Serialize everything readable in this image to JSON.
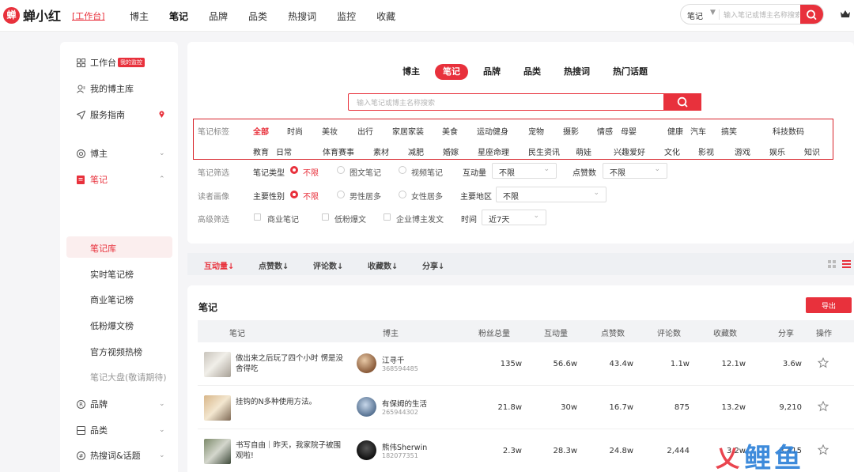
{
  "brand": {
    "logo_mark": "蝉",
    "name": "蝉小红",
    "workbench_link": "[工作台]"
  },
  "top_nav": [
    {
      "label": "博主",
      "active": false
    },
    {
      "label": "笔记",
      "active": true
    },
    {
      "label": "品牌",
      "active": false
    },
    {
      "label": "品类",
      "active": false
    },
    {
      "label": "热搜词",
      "active": false
    },
    {
      "label": "监控",
      "active": false
    },
    {
      "label": "收藏",
      "active": false
    }
  ],
  "top_search": {
    "scope": "笔记",
    "placeholder": "输入笔记或博主名称搜索"
  },
  "sidebar": {
    "workbench": {
      "label": "工作台",
      "badge": "我的监控"
    },
    "blogger_lib": {
      "label": "我的博主库"
    },
    "guide": {
      "label": "服务指南"
    },
    "blogger": {
      "label": "博主"
    },
    "notes": {
      "label": "笔记"
    },
    "notes_sub": [
      "笔记库",
      "实时笔记榜",
      "商业笔记榜",
      "低粉爆文榜",
      "官方视频热榜",
      "笔记大盘(敬请期待)"
    ],
    "brand": {
      "label": "品牌"
    },
    "category": {
      "label": "品类"
    },
    "hot": {
      "label": "热搜词&话题"
    }
  },
  "filter": {
    "tabs": [
      "博主",
      "笔记",
      "品牌",
      "品类",
      "热搜词",
      "热门话题"
    ],
    "active_tab": "笔记",
    "search_placeholder": "输入笔记或博主名称搜索",
    "tag_label": "笔记标签",
    "tags_row1": [
      "全部",
      "时尚",
      "美妆",
      "出行",
      "家居家装",
      "美食",
      "运动健身",
      "宠物",
      "摄影",
      "情感",
      "母婴",
      "健康",
      "汽车",
      "搞笑",
      "科技数码"
    ],
    "tags_row2": [
      "教育",
      "日常",
      "体育赛事",
      "素材",
      "减肥",
      "婚嫁",
      "星座命理",
      "民生资讯",
      "萌娃",
      "兴趣爱好",
      "文化",
      "影视",
      "游戏",
      "娱乐",
      "知识"
    ],
    "note_filter": {
      "label": "笔记筛选",
      "type_label": "笔记类型",
      "types": [
        "不限",
        "图文笔记",
        "视频笔记"
      ],
      "interact_label": "互动量",
      "interact_value": "不限",
      "likes_label": "点赞数",
      "likes_value": "不限"
    },
    "reader": {
      "label": "读者画像",
      "gender_label": "主要性别",
      "genders": [
        "不限",
        "男性居多",
        "女性居多"
      ],
      "region_label": "主要地区",
      "region_value": "不限"
    },
    "advanced": {
      "label": "高级筛选",
      "checks": [
        "商业笔记",
        "低粉爆文",
        "企业博主发文"
      ],
      "time_label": "时间",
      "time_value": "近7天"
    }
  },
  "sort_bar": [
    "互动量",
    "点赞数",
    "评论数",
    "收藏数",
    "分享"
  ],
  "table": {
    "title": "笔记",
    "export_label": "导出",
    "headers": [
      "笔记",
      "博主",
      "粉丝总量",
      "互动量",
      "点赞数",
      "评论数",
      "收藏数",
      "分享",
      "操作"
    ],
    "rows": [
      {
        "title": "做出来之后玩了四个小时 愣是没舍得吃",
        "blogger": "江寻千",
        "blogger_id": "368594485",
        "fans": "135w",
        "interact": "56.6w",
        "likes": "43.4w",
        "comments": "1.1w",
        "favorites": "12.1w",
        "shares": "3.6w"
      },
      {
        "title": "挂钩的N多种使用方法。",
        "blogger": "有保姆的生活",
        "blogger_id": "265944302",
        "fans": "21.8w",
        "interact": "30w",
        "likes": "16.7w",
        "comments": "875",
        "favorites": "13.2w",
        "shares": "9,210"
      },
      {
        "title": "书写自由｜昨天，我家院子被围观啦!",
        "blogger": "熊伟Sherwin",
        "blogger_id": "182077351",
        "fans": "2.3w",
        "interact": "28.3w",
        "likes": "24.8w",
        "comments": "2,444",
        "favorites": "3.2w",
        "shares": "3,415"
      }
    ]
  },
  "watermark": {
    "mark": "乂",
    "text": "鲤鱼"
  },
  "colors": {
    "accent": "#e8313c",
    "tag_box_border": "#d8232a",
    "page_bg": "#f5f5f7"
  },
  "icons": [
    "logo-mark-icon",
    "search-icon",
    "crown-icon",
    "grid-icon",
    "user-icon",
    "send-icon",
    "location-icon",
    "circle-icon",
    "note-icon",
    "registered-icon",
    "box-icon",
    "hash-icon",
    "star-icon",
    "grid-view-icon",
    "list-view-icon"
  ]
}
